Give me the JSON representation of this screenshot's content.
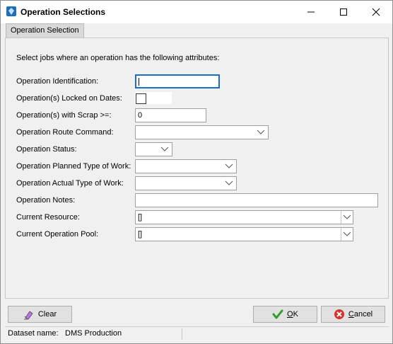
{
  "window": {
    "title": "Operation Selections",
    "controls": {
      "minimize": "minimize",
      "maximize": "maximize",
      "close": "close"
    }
  },
  "tabs": [
    {
      "label": "Operation Selection"
    }
  ],
  "form": {
    "intro": "Select jobs where an operation has the following attributes:",
    "fields": {
      "operation_identification": {
        "label": "Operation Identification:",
        "value": ""
      },
      "locked_on_dates": {
        "label": "Operation(s) Locked on Dates:",
        "checked": false
      },
      "with_scrap": {
        "label": "Operation(s) with Scrap >=:",
        "value": "0"
      },
      "route_command": {
        "label": "Operation Route Command:",
        "value": ""
      },
      "status": {
        "label": "Operation Status:",
        "value": ""
      },
      "planned_type": {
        "label": "Operation Planned Type of Work:",
        "value": ""
      },
      "actual_type": {
        "label": "Operation Actual Type of Work:",
        "value": ""
      },
      "notes": {
        "label": "Operation Notes:",
        "value": ""
      },
      "current_resource": {
        "label": "Current Resource:",
        "value": "[]"
      },
      "current_pool": {
        "label": "Current Operation Pool:",
        "value": "[]"
      }
    }
  },
  "buttons": {
    "clear": {
      "label": "Clear",
      "icon": "eraser-icon"
    },
    "ok": {
      "label_underlined": "O",
      "label_rest": "K",
      "icon": "checkmark-icon"
    },
    "cancel": {
      "label_underlined": "C",
      "label_rest": "ancel",
      "icon": "cancel-icon"
    }
  },
  "status_bar": {
    "label": "Dataset name:",
    "value": "DMS Production"
  },
  "colors": {
    "focus_border": "#1a6fc4",
    "ok_green": "#2e9d2e",
    "cancel_red": "#d9342b"
  }
}
